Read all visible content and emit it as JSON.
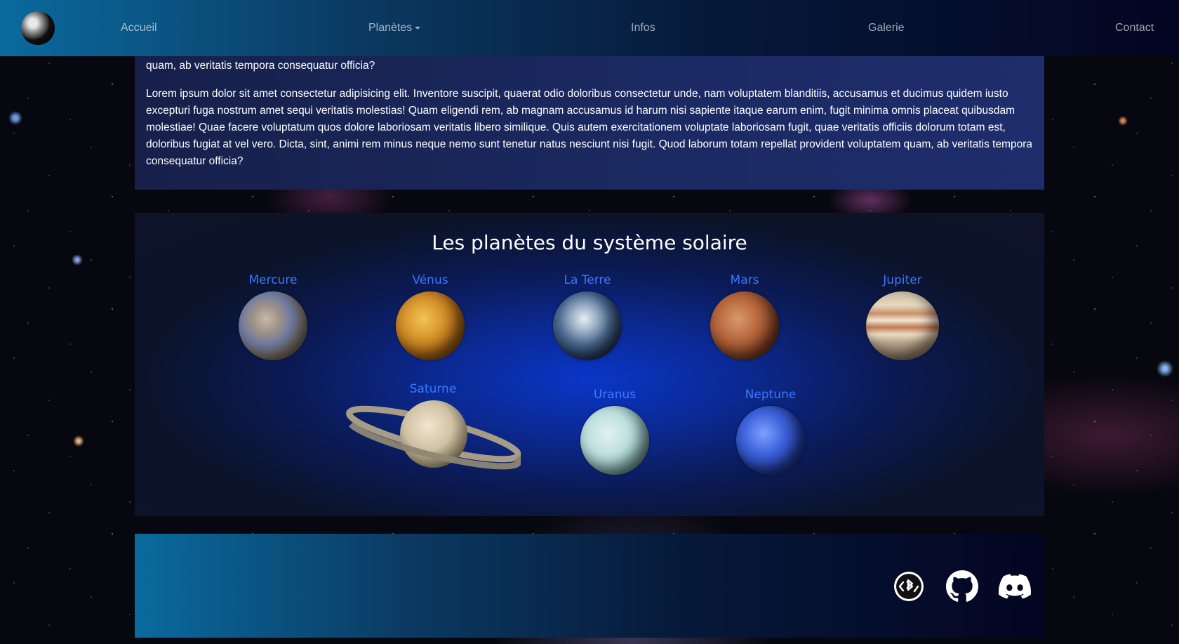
{
  "navbar": {
    "logo_icon": "earth-icon",
    "links": [
      "Accueil",
      "Planètes",
      "Infos",
      "Galerie",
      "Contact"
    ]
  },
  "intro": {
    "paragraph_tail": "quam, ab veritatis tempora consequatur officia?",
    "paragraph": "Lorem ipsum dolor sit amet consectetur adipisicing elit. Inventore suscipit, quaerat odio doloribus consectetur unde, nam voluptatem blanditiis, accusamus et ducimus quidem iusto excepturi fuga nostrum amet sequi veritatis molestias! Quam eligendi rem, ab magnam accusamus id harum nisi sapiente itaque earum enim, fugit minima omnis placeat quibusdam molestiae! Quae facere voluptatum quos dolore laboriosam veritatis libero similique. Quis autem exercitationem voluptate laboriosam fugit, quae veritatis officiis dolorum totam est, doloribus fugiat at vel vero. Dicta, sint, animi rem minus neque nemo sunt tenetur natus nesciunt nisi fugit. Quod laborum totam repellat provident voluptatem quam, ab veritatis tempora consequatur officia?"
  },
  "planets_section": {
    "title": "Les planètes du système solaire",
    "planets": [
      "Mercure",
      "Vénus",
      "La Terre",
      "Mars",
      "Jupiter",
      "Saturne",
      "Uranus",
      "Neptune"
    ]
  },
  "footer": {
    "social_icons": [
      "bluetooth-code-icon",
      "github-icon",
      "discord-icon"
    ]
  },
  "colors": {
    "planet_label": "#3a78ff",
    "nav_gradient_start": "#0a6a9e",
    "nav_gradient_end": "#030521"
  }
}
